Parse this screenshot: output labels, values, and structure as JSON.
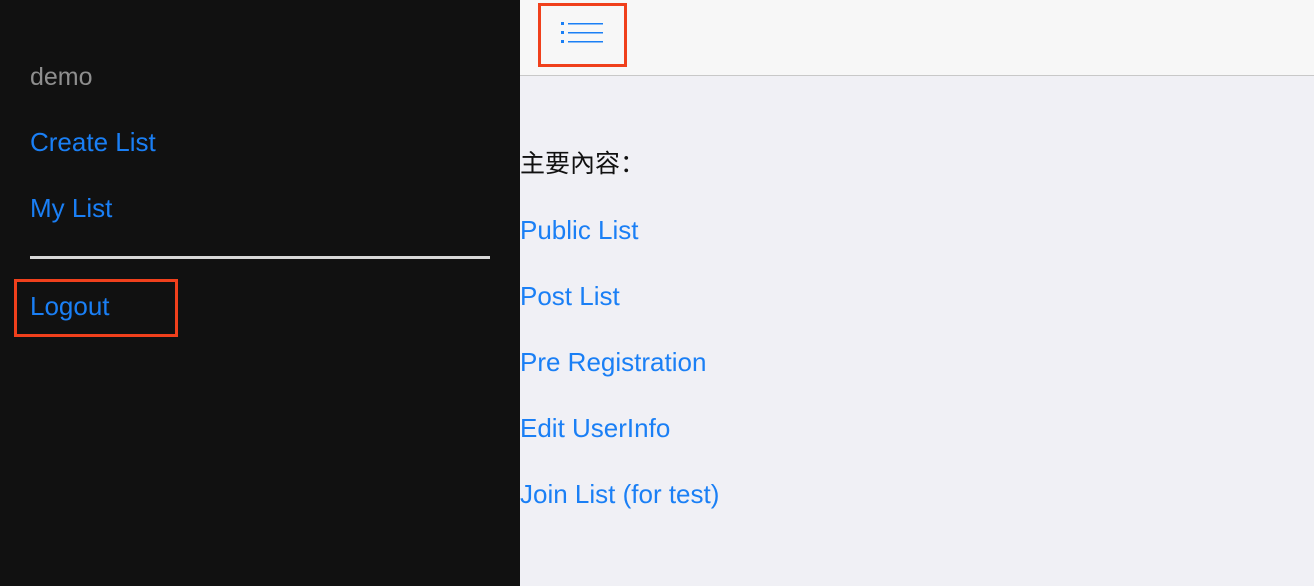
{
  "sidebar": {
    "username": "demo",
    "items": [
      {
        "label": "Create List"
      },
      {
        "label": "My List"
      }
    ],
    "logout_label": "Logout"
  },
  "header": {
    "menu_icon": "list-menu-icon"
  },
  "main": {
    "section_label": "主要內容：",
    "links": [
      {
        "label": "Public List"
      },
      {
        "label": "Post List"
      },
      {
        "label": "Pre Registration"
      },
      {
        "label": "Edit UserInfo"
      },
      {
        "label": "Join List (for test)"
      }
    ]
  },
  "colors": {
    "sidebar_bg": "#111111",
    "link": "#1a7ff5",
    "highlight_border": "#f0401c",
    "content_bg": "#f0f0f5",
    "header_bg": "#f7f7f7"
  }
}
